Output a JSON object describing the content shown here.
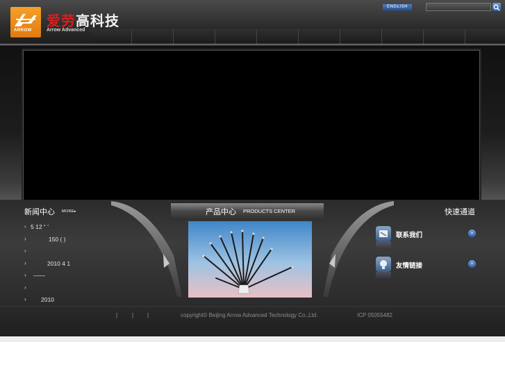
{
  "header": {
    "logo_sub": "ARROW",
    "brand_cn_red": "爱劳",
    "brand_cn_white": "高科技",
    "brand_en": "Arrow Advanced",
    "lang_button": "ENGLISH",
    "search_placeholder": "",
    "nav_items": [
      "",
      "",
      "",
      "",
      "",
      "",
      "",
      "",
      "",
      ""
    ]
  },
  "news": {
    "title": "新闻中心",
    "more": "MORE",
    "items": [
      "5 12 “ ’",
      "150 ( )",
      "",
      "2010 4 1",
      "——",
      "",
      "2010"
    ]
  },
  "products": {
    "title_cn": "产品中心",
    "title_en": "PRODUCTS CENTER"
  },
  "quick": {
    "title": "快速通道",
    "items": [
      {
        "label": "联系我们",
        "icon": "contact-icon"
      },
      {
        "label": "友情链接",
        "icon": "link-icon"
      }
    ],
    "go_glyph": "»"
  },
  "footer": {
    "links": [
      "|",
      "|",
      "|"
    ],
    "copyright": "copyright© Beijing Arrow Advanced Technology Co.,Ltd.",
    "icp": "ICP 05055482"
  },
  "colors": {
    "brand_red": "#d61f1f",
    "logo_orange": "#f09020",
    "accent_blue": "#2f5c99"
  }
}
